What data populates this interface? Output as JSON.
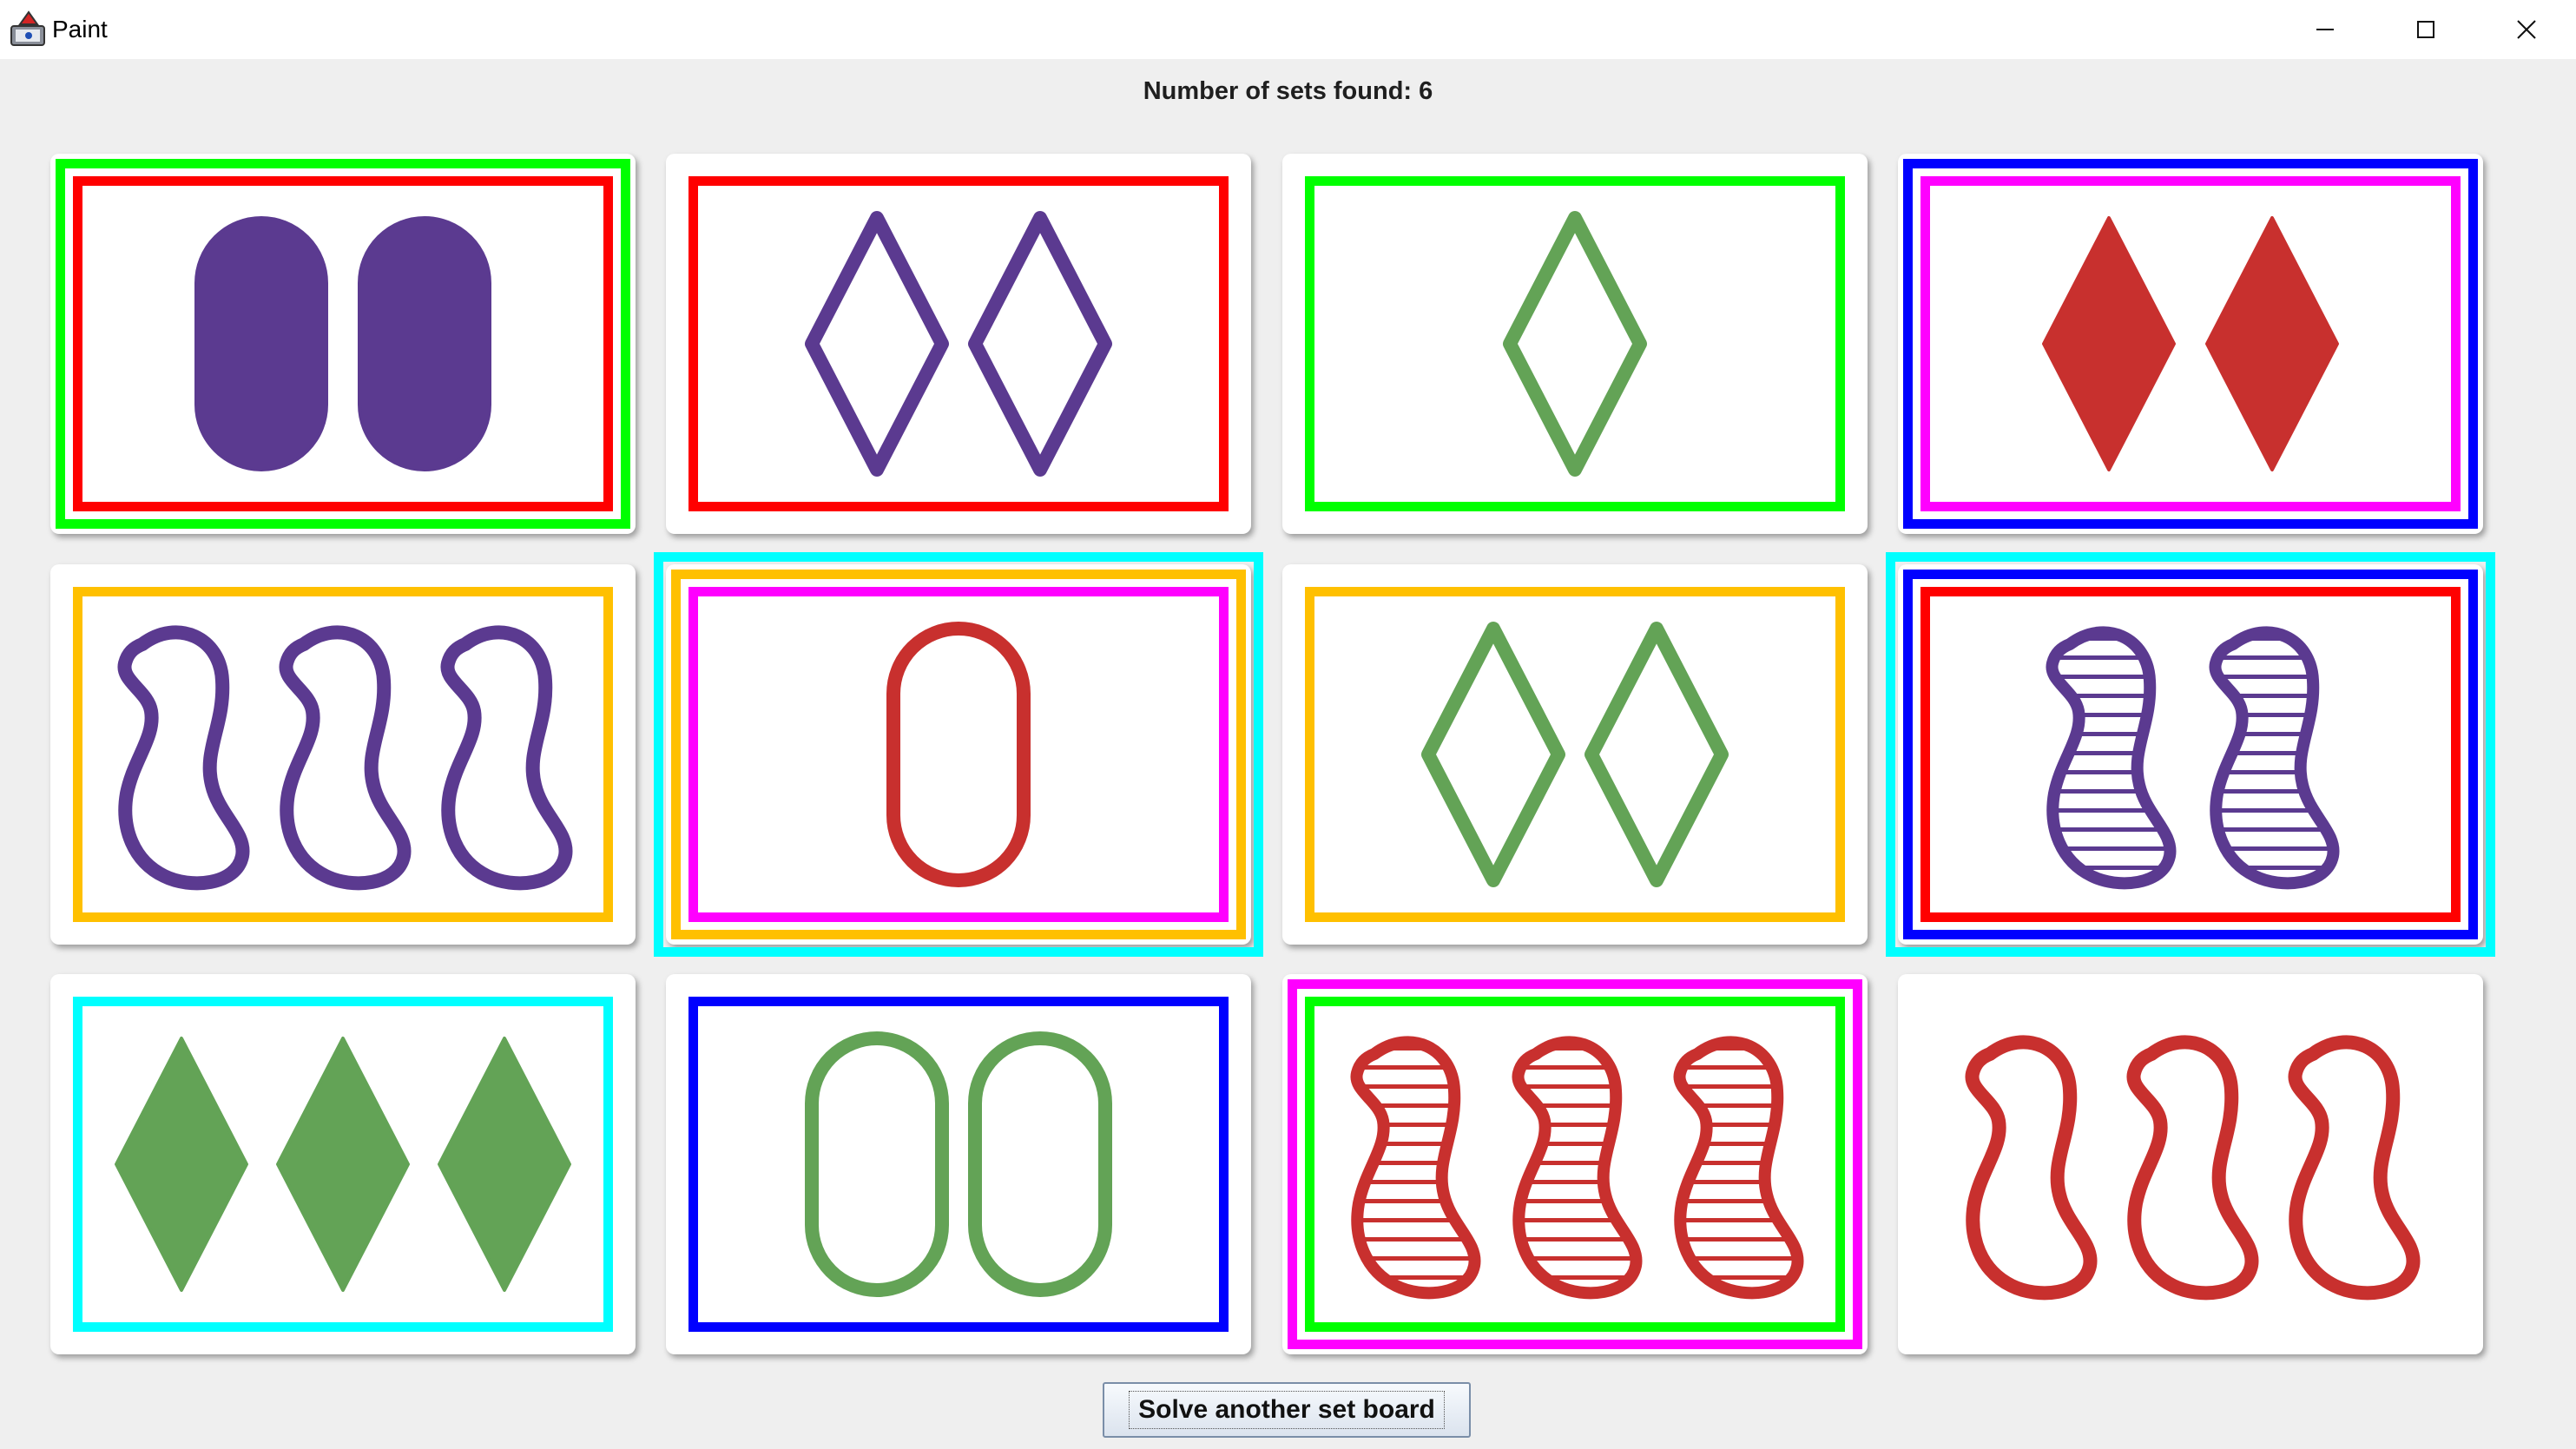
{
  "window": {
    "title": "Paint",
    "minimize_glyph": "—",
    "maximize_glyph": "☐",
    "close_glyph": "✕"
  },
  "status": {
    "label": "Number of sets found: 6"
  },
  "solve_button": {
    "label": "Solve another set board"
  },
  "palette": {
    "purple": "#5b3a90",
    "green": "#63a356",
    "red": "#c8302e",
    "highlight_green": "#00ff00",
    "highlight_red": "#ff0000",
    "highlight_blue": "#0000ff",
    "highlight_magenta": "#ff00ff",
    "highlight_orange": "#ffc000",
    "highlight_cyan": "#00ffff"
  },
  "cards": [
    {
      "count": 2,
      "shape": "oval",
      "color": "purple",
      "fill": "solid",
      "highlights": [
        "highlight_green",
        "highlight_red"
      ]
    },
    {
      "count": 2,
      "shape": "diamond",
      "color": "purple",
      "fill": "outline",
      "highlights": [
        "highlight_red"
      ]
    },
    {
      "count": 1,
      "shape": "diamond",
      "color": "green",
      "fill": "outline",
      "highlights": [
        "highlight_green"
      ]
    },
    {
      "count": 2,
      "shape": "diamond",
      "color": "red",
      "fill": "solid",
      "highlights": [
        "highlight_blue",
        "highlight_magenta"
      ]
    },
    {
      "count": 3,
      "shape": "squiggle",
      "color": "purple",
      "fill": "outline",
      "highlights": [
        "highlight_orange"
      ]
    },
    {
      "count": 1,
      "shape": "oval",
      "color": "red",
      "fill": "outline",
      "highlights": [
        "highlight_cyan",
        "highlight_orange",
        "highlight_magenta"
      ]
    },
    {
      "count": 2,
      "shape": "diamond",
      "color": "green",
      "fill": "outline",
      "highlights": [
        "highlight_orange"
      ]
    },
    {
      "count": 2,
      "shape": "squiggle",
      "color": "purple",
      "fill": "striped",
      "highlights": [
        "highlight_cyan",
        "highlight_blue",
        "highlight_red"
      ]
    },
    {
      "count": 3,
      "shape": "diamond",
      "color": "green",
      "fill": "solid",
      "highlights": [
        "highlight_cyan"
      ]
    },
    {
      "count": 2,
      "shape": "oval",
      "color": "green",
      "fill": "outline",
      "highlights": [
        "highlight_blue"
      ]
    },
    {
      "count": 3,
      "shape": "squiggle",
      "color": "red",
      "fill": "striped",
      "highlights": [
        "highlight_magenta",
        "highlight_green"
      ]
    },
    {
      "count": 3,
      "shape": "squiggle",
      "color": "red",
      "fill": "outline",
      "highlights": []
    }
  ]
}
